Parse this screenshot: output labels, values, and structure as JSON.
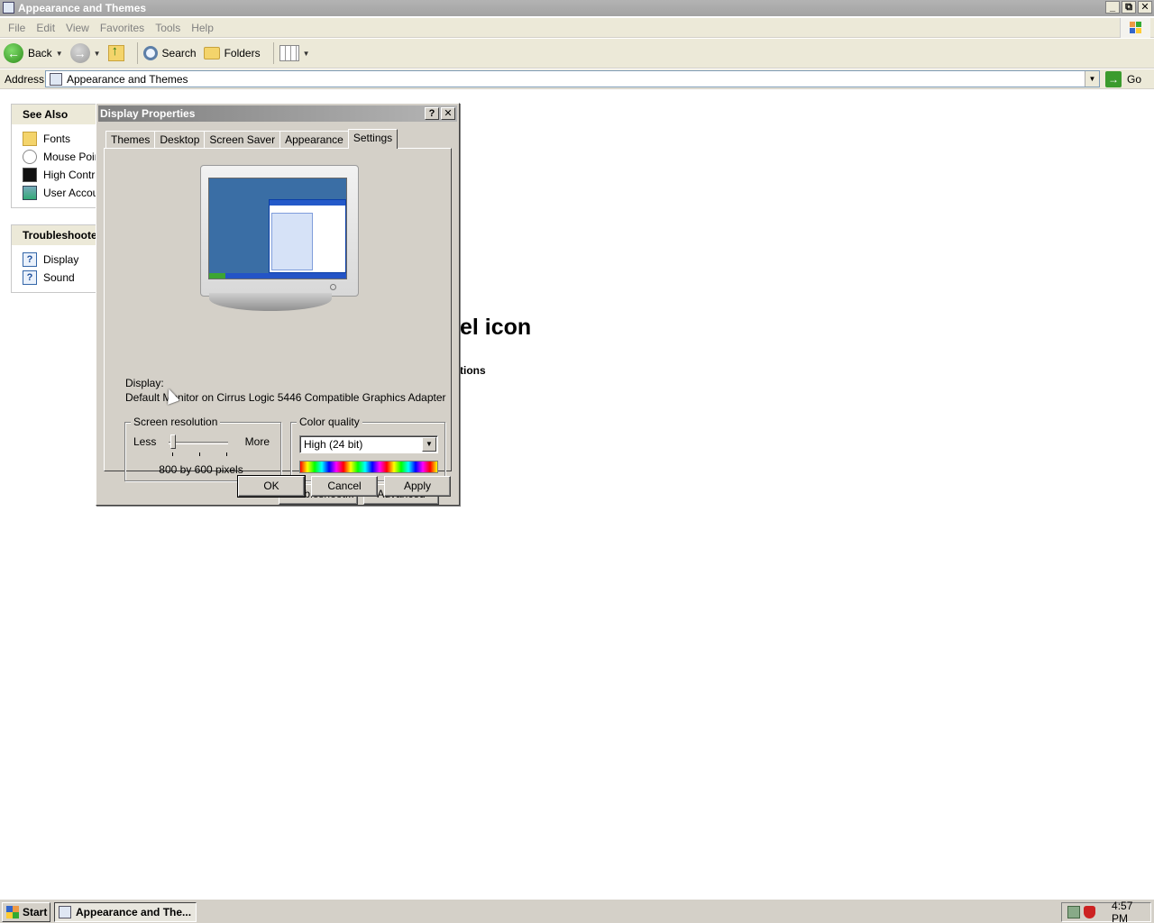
{
  "window": {
    "title": "Appearance and Themes",
    "controls": [
      "_",
      "⧉",
      "✕"
    ]
  },
  "menu": [
    "File",
    "Edit",
    "View",
    "Favorites",
    "Tools",
    "Help"
  ],
  "toolbar": {
    "back": "Back",
    "search": "Search",
    "folders": "Folders"
  },
  "address": {
    "label": "Address",
    "value": "Appearance and Themes",
    "go": "Go"
  },
  "see_also": {
    "title": "See Also",
    "items": [
      "Fonts",
      "Mouse Pointers",
      "High Contrast",
      "User Account Picture"
    ]
  },
  "troubleshooters": {
    "title": "Troubleshooters",
    "items": [
      "Display",
      "Sound"
    ]
  },
  "background": {
    "heading": "el icon",
    "subtext": "tions"
  },
  "dialog": {
    "title": "Display Properties",
    "help": "?",
    "close": "✕",
    "tabs": [
      "Themes",
      "Desktop",
      "Screen Saver",
      "Appearance",
      "Settings"
    ],
    "active_tab": "Settings",
    "display_label": "Display:",
    "display_value": "Default Monitor on Cirrus Logic 5446 Compatible Graphics Adapter",
    "resolution": {
      "legend": "Screen resolution",
      "less": "Less",
      "more": "More",
      "value": "800 by 600 pixels",
      "slider_position": 0
    },
    "color_quality": {
      "legend": "Color quality",
      "selected": "High (24 bit)"
    },
    "buttons": {
      "troubleshoot": "Troubleshoot...",
      "advanced": "Advanced",
      "ok": "OK",
      "cancel": "Cancel",
      "apply": "Apply"
    }
  },
  "taskbar": {
    "start": "Start",
    "task": "Appearance and The...",
    "clock": "4:57 PM"
  }
}
